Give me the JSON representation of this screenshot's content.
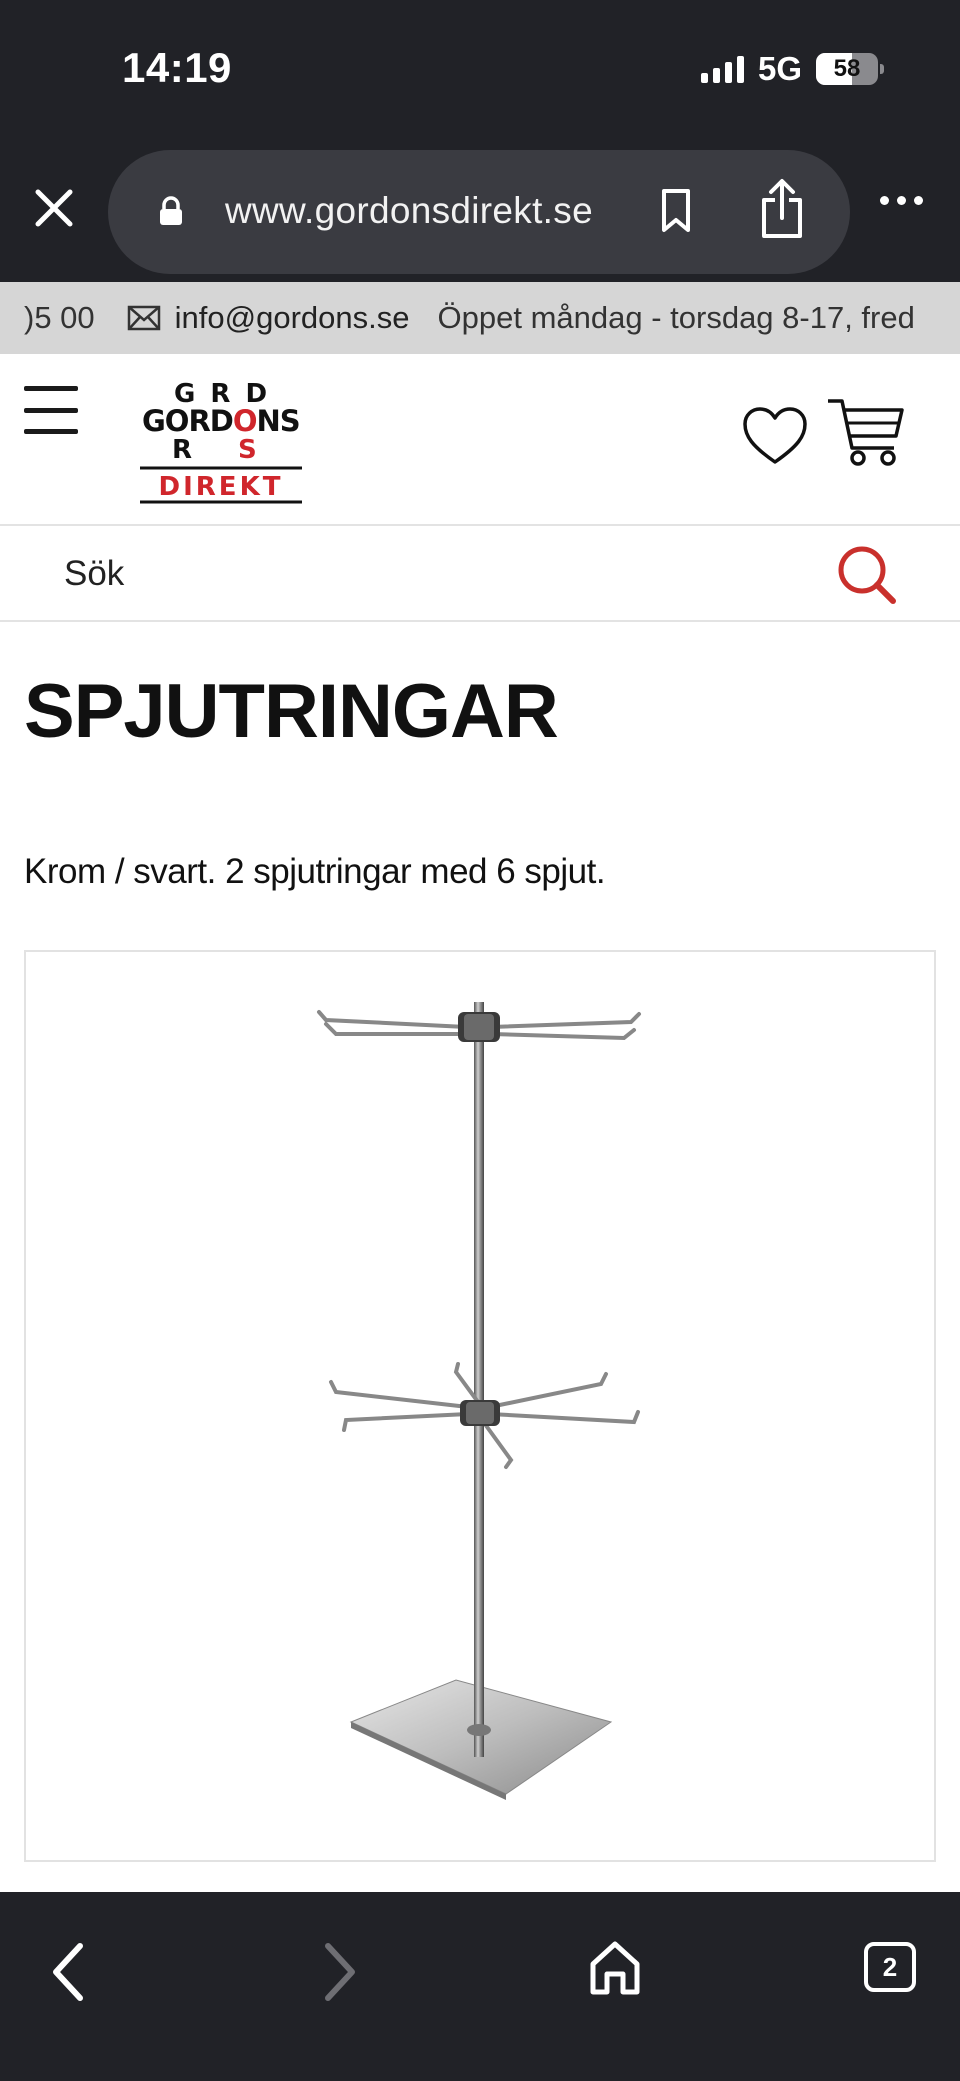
{
  "status_bar": {
    "time": "14:19",
    "network": "5G",
    "battery": "58",
    "battery_percent": 58
  },
  "browser": {
    "url": "www.gordonsdirekt.se",
    "open_tabs": "2",
    "icons": [
      "close-icon",
      "lock-icon",
      "bookmark-icon",
      "share-icon",
      "more-icon",
      "back-icon",
      "forward-icon",
      "home-icon",
      "tabs-icon"
    ]
  },
  "info_bar": {
    "phone_fragment": ")5 00",
    "email": "info@gordons.se",
    "hours": "Öppet måndag - torsdag 8-17, fred"
  },
  "header": {
    "logo": {
      "row1": "G R D",
      "row2": "GORDONS",
      "row3": "R   S",
      "row4": "DIREKT"
    },
    "icons": [
      "menu-icon",
      "heart-icon",
      "cart-icon"
    ]
  },
  "search": {
    "label": "Sök"
  },
  "product": {
    "title": "SPJUTRINGAR",
    "description": "Krom / svart. 2 spjutringar med 6 spjut."
  },
  "colors": {
    "chrome_bg": "#212227",
    "urlbar_bg": "#3a3b41",
    "infobar_bg": "#d6d6d6",
    "brand_red": "#d0262c",
    "search_icon": "#c9302c"
  }
}
